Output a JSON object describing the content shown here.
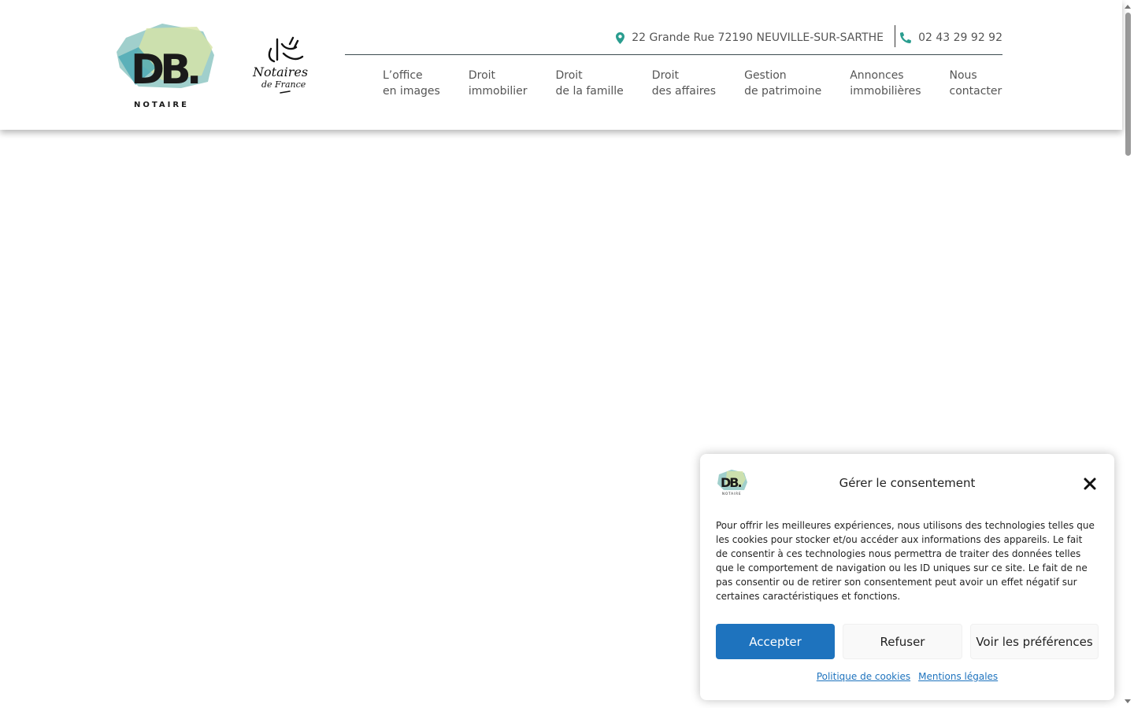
{
  "header": {
    "logo_db_text": "DB.",
    "logo_db_subtext": "NOTAIRE",
    "logo_notaires_line1": "Notaires",
    "logo_notaires_line2": "de France",
    "address": "22 Grande Rue 72190 NEUVILLE-SUR-SARTHE",
    "phone": "02 43 29 92 92",
    "icons": {
      "address": "map-pin-icon",
      "phone": "phone-icon"
    },
    "accent_color": "#2a9d8f"
  },
  "nav": {
    "items": [
      {
        "line1": "L’office",
        "line2": "en images"
      },
      {
        "line1": "Droit",
        "line2": "immobilier"
      },
      {
        "line1": "Droit",
        "line2": "de la famille"
      },
      {
        "line1": "Droit",
        "line2": "des affaires"
      },
      {
        "line1": "Gestion",
        "line2": "de patrimoine"
      },
      {
        "line1": "Annonces",
        "line2": "immobilières"
      },
      {
        "line1": "Nous",
        "line2": "contacter"
      }
    ]
  },
  "cookie": {
    "title": "Gérer le consentement",
    "text": "Pour offrir les meilleures expériences, nous utilisons des technologies telles que les cookies pour stocker et/ou accéder aux informations des appareils. Le fait de consentir à ces technologies nous permettra de traiter des données telles que le comportement de navigation ou les ID uniques sur ce site. Le fait de ne pas consentir ou de retirer son consentement peut avoir un effet négatif sur certaines caractéristiques et fonctions.",
    "accept_label": "Accepter",
    "refuse_label": "Refuser",
    "prefs_label": "Voir les préférences",
    "link_cookies": "Politique de cookies",
    "link_legal": "Mentions légales",
    "accept_color": "#1e73be",
    "close_icon": "close-icon"
  }
}
